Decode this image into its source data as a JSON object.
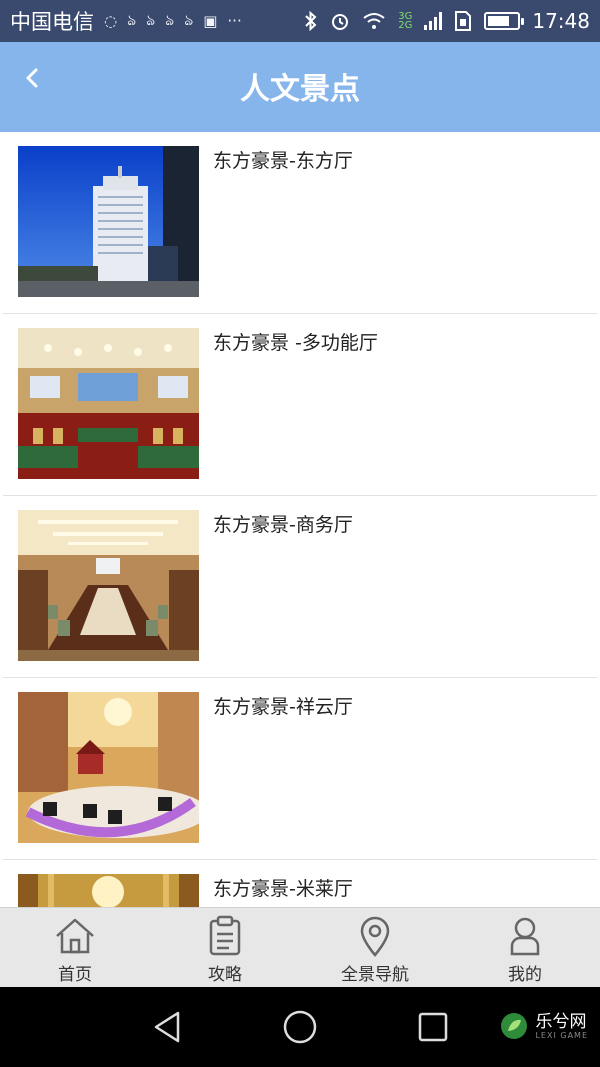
{
  "status_bar": {
    "carrier": "中国电信",
    "time": "17:48",
    "network": [
      "3G",
      "2G"
    ],
    "battery_level": 0.78,
    "icons": [
      "message-icon",
      "app-icon",
      "app-icon",
      "app-icon",
      "app-icon",
      "image-icon",
      "more-icon",
      "bluetooth-icon",
      "alarm-icon",
      "wifi-icon",
      "signal-icon",
      "sim-icon",
      "battery-icon"
    ],
    "more": "···"
  },
  "header": {
    "title": "人文景点",
    "background": "#86b5ec"
  },
  "items": [
    {
      "title": "东方豪景-东方厅",
      "image": "hotel-building"
    },
    {
      "title": "东方豪景 -多功能厅",
      "image": "conference-hall"
    },
    {
      "title": "东方豪景-商务厅",
      "image": "meeting-room"
    },
    {
      "title": "东方豪景-祥云厅",
      "image": "lobby"
    },
    {
      "title": "东方豪景-米莱厅",
      "image": "restaurant"
    }
  ],
  "tabs": [
    {
      "label": "首页",
      "icon": "home-icon"
    },
    {
      "label": "攻略",
      "icon": "clipboard-icon"
    },
    {
      "label": "全景导航",
      "icon": "location-pin-icon"
    },
    {
      "label": "我的",
      "icon": "user-icon"
    }
  ],
  "watermark": {
    "text": "乐兮网",
    "sub": "LEXI GAME"
  }
}
